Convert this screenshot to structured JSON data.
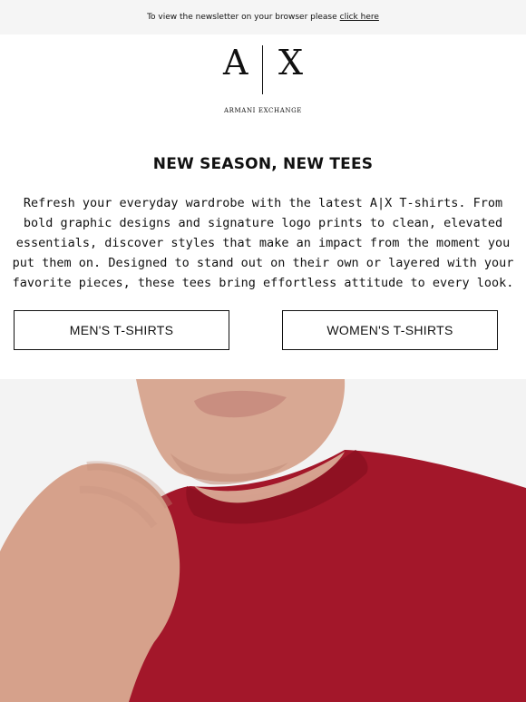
{
  "preheader": {
    "text": "To view the newsletter on your browser please",
    "link_label": "click here"
  },
  "logo": {
    "letter_left": "A",
    "letter_right": "X",
    "subtitle": "ARMANI EXCHANGE"
  },
  "headline": "NEW SEASON, NEW TEES",
  "body_copy": "Refresh your everyday wardrobe with the latest A|X T-shirts. From bold graphic designs and signature logo prints to clean, elevated essentials, discover styles that make an impact from the moment you put them on. Designed to stand out on their own or layered with your favorite pieces, these tees bring effortless attitude to every look.",
  "buttons": {
    "men_label": "MEN'S T-SHIRTS",
    "women_label": "WOMEN'S T-SHIRTS"
  },
  "colors": {
    "text": "#111111",
    "preheader_bg": "#f5f5f5",
    "hero_bg": "#f2f2f2",
    "tee_red": "#a3172a",
    "skin": "#d7a48f"
  }
}
